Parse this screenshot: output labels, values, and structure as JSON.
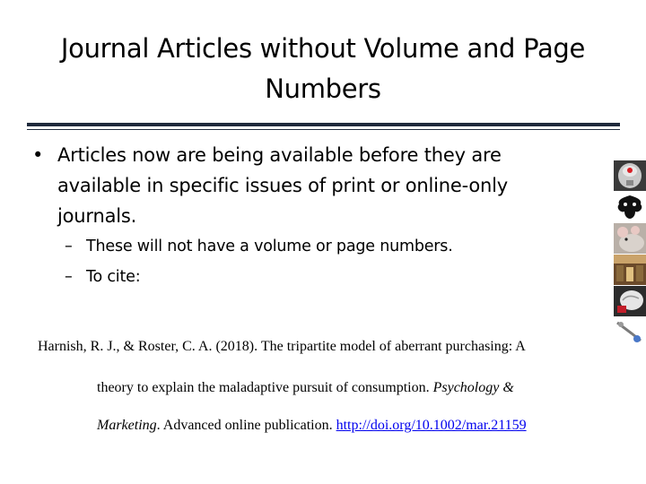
{
  "title": "Journal Articles without Volume and Page Numbers",
  "bullets": [
    {
      "level": 1,
      "text": "Articles now are being available before they are available in specific issues of print or online-only journals.",
      "lines": [
        "Articles now are being available before they are",
        "available in specific issues of print or online-only",
        "journals."
      ]
    },
    {
      "level": 2,
      "text": "These will not have a volume or page numbers."
    },
    {
      "level": 2,
      "text": "To cite:"
    }
  ],
  "bullet_marks": {
    "level1": "•",
    "level2": "–"
  },
  "citation": {
    "line1": "Harnish, R. J., & Roster, C. A. (2018). The tripartite model of aberrant purchasing: A",
    "line2_plain": "theory to explain the maladaptive pursuit of consumption. ",
    "line2_italic": "Psychology &",
    "line3_italic": "Marketing",
    "line3_plain": ". Advanced online publication. ",
    "link": "http://doi.org/10.1002/mar.21159"
  },
  "side_images": [
    "brain-art-icon",
    "inkblot-icon",
    "mouse-photo-icon",
    "library-photo-icon",
    "brain-model-icon",
    "neuron-icon"
  ],
  "colors": {
    "rule": "#1f2a3c",
    "link": "#0000ee",
    "text": "#000000"
  }
}
